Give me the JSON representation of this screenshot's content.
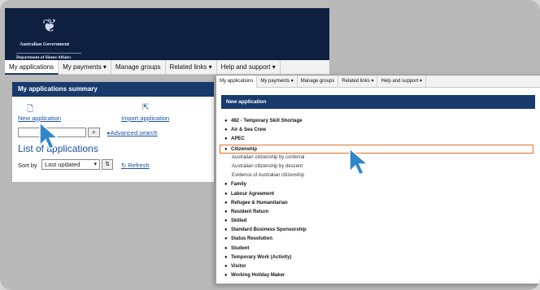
{
  "back_window": {
    "header": {
      "line1": "Australian Government",
      "line2": "Department of Home Affairs"
    },
    "nav": [
      {
        "label": "My applications"
      },
      {
        "label": "My payments ▾"
      },
      {
        "label": "Manage groups"
      },
      {
        "label": "Related links ▾"
      },
      {
        "label": "Help and support ▾"
      }
    ],
    "summary": {
      "title": "My applications summary",
      "new_application": "New application",
      "import_application": "Import application",
      "advanced_search": "Advanced search",
      "list_title": "List of applications",
      "sort_label": "Sort by",
      "sort_value": "Last updated",
      "refresh": "Refresh"
    }
  },
  "front_window": {
    "nav": [
      {
        "label": "My applications"
      },
      {
        "label": "My payments ▾"
      },
      {
        "label": "Manage groups"
      },
      {
        "label": "Related links ▾"
      },
      {
        "label": "Help and support ▾"
      }
    ],
    "title": "New application",
    "items": [
      "482 - Temporary Skill Shortage",
      "Air & Sea Crew",
      "APEC",
      "Citizenship",
      "Australian citizenship by conferral",
      "Australian citizenship by descent",
      "Evidence of Australian citizenship",
      "Family",
      "Labour Agreement",
      "Refugee & Humanitarian",
      "Resident Return",
      "Skilled",
      "Standard Business Sponsorship",
      "Status Resolution",
      "Student",
      "Temporary Work (Activity)",
      "Visitor",
      "Working Holiday Maker"
    ]
  },
  "colors": {
    "header_bg": "#0e1f40",
    "title_bar": "#183a6c",
    "link": "#1a4fa0",
    "highlight": "#e0702a",
    "cursor": "#2f86c8"
  }
}
